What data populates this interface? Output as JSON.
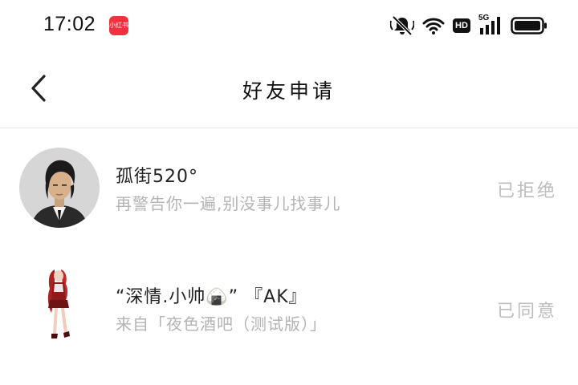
{
  "status_bar": {
    "time": "17:02",
    "app_badge": "小红书",
    "hd": "HD",
    "network": "5G"
  },
  "header": {
    "title": "好友申请",
    "back_icon": "chevron-left-icon"
  },
  "requests": [
    {
      "name": "孤街520°",
      "message": "再警告你一遍,别没事儿找事儿",
      "status": "已拒绝"
    },
    {
      "name": "“深情.小帅🍙” 『AK』",
      "message": "来自「夜色酒吧（测试版）」",
      "status": "已同意"
    }
  ]
}
